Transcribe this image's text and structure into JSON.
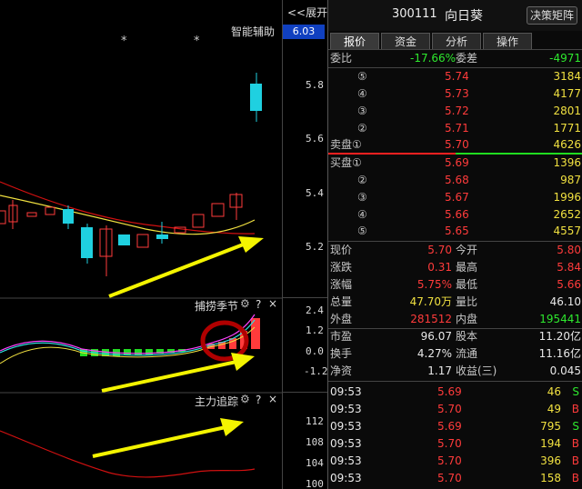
{
  "chart": {
    "expand_label": "<<展开",
    "current_price_tag": "6.03",
    "indicator_label": "智能辅助",
    "stars": [
      "*",
      "*"
    ],
    "price_axis": [
      "5.8",
      "5.6",
      "5.4",
      "5.2"
    ],
    "sub1_title": "捕捞季节",
    "sub1_axis": [
      "2.4",
      "1.2",
      "0.0",
      "-1.2"
    ],
    "sub2_title": "主力追踪",
    "sub2_axis": [
      "112",
      "108",
      "104",
      "100"
    ],
    "gear_icon": "gear-icon",
    "help_symbol": "?",
    "close_symbol": "×",
    "colors": {
      "up": "#ff3b3b",
      "down": "#1fd0e0",
      "arrow": "#f4f400",
      "ma1": "#f0e040",
      "ma2": "#d01010"
    }
  },
  "header": {
    "code": "300111",
    "name": "向日葵",
    "decision_button": "决策矩阵"
  },
  "tabs": [
    "报价",
    "资金",
    "分析",
    "操作"
  ],
  "order_book": {
    "weibi_label": "委比",
    "weibi_value": "-17.66%",
    "weicha_label": "委差",
    "weicha_value": "-4971",
    "sell": [
      {
        "level": "⑤",
        "price": "5.74",
        "vol": "3184"
      },
      {
        "level": "④",
        "price": "5.73",
        "vol": "4177"
      },
      {
        "level": "③",
        "price": "5.72",
        "vol": "2801"
      },
      {
        "level": "②",
        "price": "5.71",
        "vol": "1771"
      },
      {
        "level": "卖盘①",
        "price": "5.70",
        "vol": "4626"
      }
    ],
    "buy": [
      {
        "level": "买盘①",
        "price": "5.69",
        "vol": "1396"
      },
      {
        "level": "②",
        "price": "5.68",
        "vol": "987"
      },
      {
        "level": "③",
        "price": "5.67",
        "vol": "1996"
      },
      {
        "level": "④",
        "price": "5.66",
        "vol": "2652"
      },
      {
        "level": "⑤",
        "price": "5.65",
        "vol": "4557"
      }
    ]
  },
  "quote": [
    {
      "l1": "现价",
      "v1": "5.70",
      "c1": "red",
      "l2": "今开",
      "v2": "5.80",
      "c2": "red"
    },
    {
      "l1": "涨跌",
      "v1": "0.31",
      "c1": "red",
      "l2": "最高",
      "v2": "5.84",
      "c2": "red"
    },
    {
      "l1": "涨幅",
      "v1": "5.75%",
      "c1": "red",
      "l2": "最低",
      "v2": "5.66",
      "c2": "red"
    },
    {
      "l1": "总量",
      "v1": "47.70万",
      "c1": "yellow",
      "l2": "量比",
      "v2": "46.10",
      "c2": "white"
    },
    {
      "l1": "外盘",
      "v1": "281512",
      "c1": "red",
      "l2": "内盘",
      "v2": "195441",
      "c2": "green"
    }
  ],
  "fundamentals": [
    {
      "l1": "市盈",
      "v1": "96.07",
      "l2": "股本",
      "v2": "11.20亿"
    },
    {
      "l1": "换手",
      "v1": "4.27%",
      "l2": "流通",
      "v2": "11.16亿"
    },
    {
      "l1": "净资",
      "v1": "1.17",
      "l2": "收益(三)",
      "v2": "0.045"
    }
  ],
  "ticks": [
    {
      "time": "09:53",
      "price": "5.69",
      "vol": "46",
      "side": "S"
    },
    {
      "time": "09:53",
      "price": "5.70",
      "vol": "49",
      "side": "B"
    },
    {
      "time": "09:53",
      "price": "5.69",
      "vol": "795",
      "side": "S"
    },
    {
      "time": "09:53",
      "price": "5.70",
      "vol": "194",
      "side": "B"
    },
    {
      "time": "09:53",
      "price": "5.70",
      "vol": "396",
      "side": "B"
    },
    {
      "time": "09:53",
      "price": "5.70",
      "vol": "158",
      "side": "B"
    }
  ]
}
